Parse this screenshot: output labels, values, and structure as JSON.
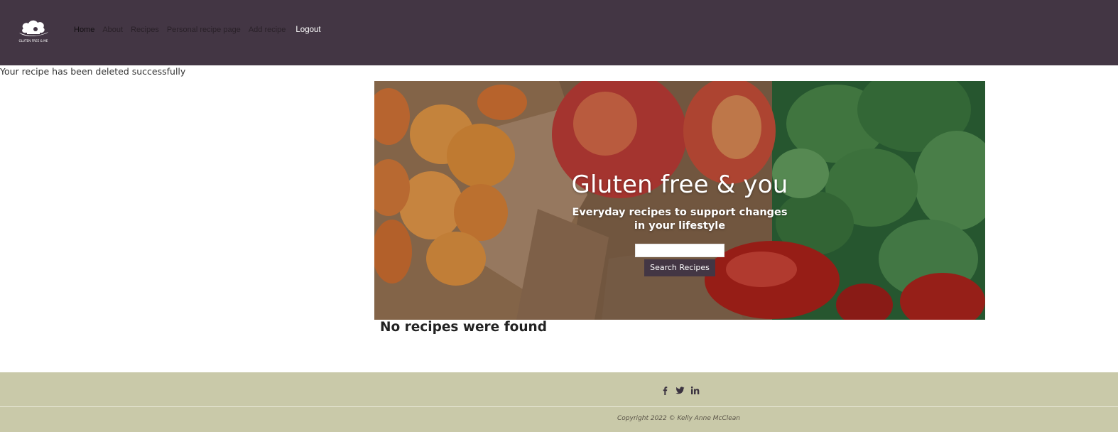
{
  "brand": {
    "logo_text": "GLUTEN FREE & ME"
  },
  "nav": {
    "items": [
      {
        "label": "Home"
      },
      {
        "label": "About"
      },
      {
        "label": "Recipes"
      },
      {
        "label": "Personal recipe page"
      },
      {
        "label": "Add recipe"
      }
    ],
    "logout_label": "Logout"
  },
  "flash": {
    "message": "Your recipe has been deleted successfully"
  },
  "hero": {
    "title": "Gluten free & you",
    "subtitle": "Everyday recipes to support changes in your lifestyle",
    "search_value": "",
    "search_button": "Search Recipes"
  },
  "results": {
    "empty_message": "No recipes were found"
  },
  "footer": {
    "social_icons": [
      "facebook-icon",
      "twitter-icon",
      "linkedin-icon"
    ],
    "copyright": "Copyright 2022 © Kelly Anne McClean"
  },
  "colors": {
    "navbar": "#433644",
    "footer": "#c9c9a9",
    "button": "#433644"
  }
}
